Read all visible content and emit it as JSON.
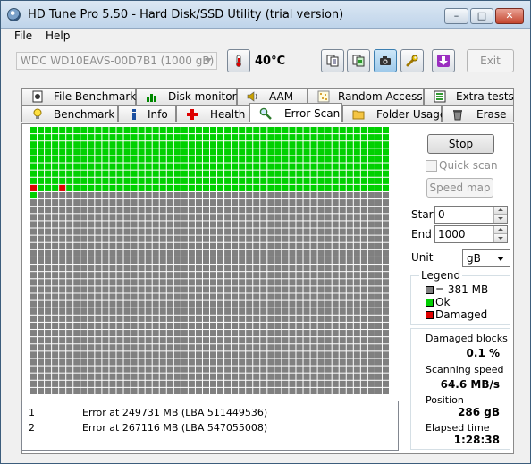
{
  "window": {
    "title": "HD Tune Pro 5.50 - Hard Disk/SSD Utility (trial version)"
  },
  "menu": {
    "file": "File",
    "help": "Help"
  },
  "toolbar": {
    "drive": "WDC WD10EAVS-00D7B1 (1000 gB)",
    "temperature": "40°C",
    "exit": "Exit"
  },
  "tabs_top": [
    "File Benchmark",
    "Disk monitor",
    "AAM",
    "Random Access",
    "Extra tests"
  ],
  "tabs_bottom": [
    "Benchmark",
    "Info",
    "Health",
    "Error Scan",
    "Folder Usage",
    "Erase"
  ],
  "active_tab": "Error Scan",
  "scan_grid": {
    "columns": 50,
    "rows": 37,
    "scanned_blocks": 451,
    "damaged_block_indices": [
      400,
      404
    ]
  },
  "errors": [
    {
      "index": "1",
      "text": "Error at 249731 MB (LBA 511449536)"
    },
    {
      "index": "2",
      "text": "Error at 267116 MB (LBA 547055008)"
    }
  ],
  "controls": {
    "stop": "Stop",
    "quick_scan": "Quick scan",
    "speed_map": "Speed map",
    "start_label": "Start",
    "start_value": "0",
    "end_label": "End",
    "end_value": "1000",
    "unit_label": "Unit",
    "unit_value": "gB"
  },
  "legend": {
    "title": "Legend",
    "block": "= 381 MB",
    "ok": "Ok",
    "damaged": "Damaged",
    "colors": {
      "block": "#808080",
      "ok": "#00d000",
      "damaged": "#e00000"
    }
  },
  "stats": {
    "damaged_label": "Damaged blocks",
    "damaged_value": "0.1 %",
    "speed_label": "Scanning speed",
    "speed_value": "64.6 MB/s",
    "position_label": "Position",
    "position_value": "286 gB",
    "elapsed_label": "Elapsed time",
    "elapsed_value": "1:28:38"
  }
}
